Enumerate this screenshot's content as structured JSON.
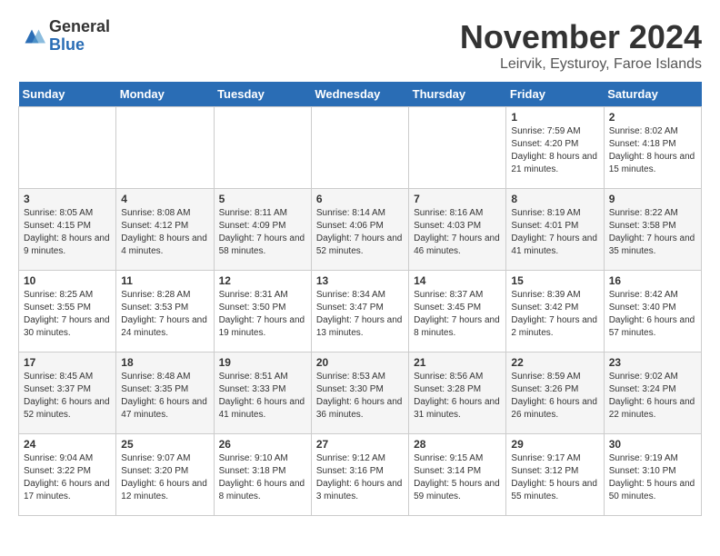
{
  "logo": {
    "general": "General",
    "blue": "Blue"
  },
  "title": "November 2024",
  "subtitle": "Leirvik, Eysturoy, Faroe Islands",
  "weekdays": [
    "Sunday",
    "Monday",
    "Tuesday",
    "Wednesday",
    "Thursday",
    "Friday",
    "Saturday"
  ],
  "weeks": [
    [
      {
        "day": "",
        "info": ""
      },
      {
        "day": "",
        "info": ""
      },
      {
        "day": "",
        "info": ""
      },
      {
        "day": "",
        "info": ""
      },
      {
        "day": "",
        "info": ""
      },
      {
        "day": "1",
        "info": "Sunrise: 7:59 AM\nSunset: 4:20 PM\nDaylight: 8 hours and 21 minutes."
      },
      {
        "day": "2",
        "info": "Sunrise: 8:02 AM\nSunset: 4:18 PM\nDaylight: 8 hours and 15 minutes."
      }
    ],
    [
      {
        "day": "3",
        "info": "Sunrise: 8:05 AM\nSunset: 4:15 PM\nDaylight: 8 hours and 9 minutes."
      },
      {
        "day": "4",
        "info": "Sunrise: 8:08 AM\nSunset: 4:12 PM\nDaylight: 8 hours and 4 minutes."
      },
      {
        "day": "5",
        "info": "Sunrise: 8:11 AM\nSunset: 4:09 PM\nDaylight: 7 hours and 58 minutes."
      },
      {
        "day": "6",
        "info": "Sunrise: 8:14 AM\nSunset: 4:06 PM\nDaylight: 7 hours and 52 minutes."
      },
      {
        "day": "7",
        "info": "Sunrise: 8:16 AM\nSunset: 4:03 PM\nDaylight: 7 hours and 46 minutes."
      },
      {
        "day": "8",
        "info": "Sunrise: 8:19 AM\nSunset: 4:01 PM\nDaylight: 7 hours and 41 minutes."
      },
      {
        "day": "9",
        "info": "Sunrise: 8:22 AM\nSunset: 3:58 PM\nDaylight: 7 hours and 35 minutes."
      }
    ],
    [
      {
        "day": "10",
        "info": "Sunrise: 8:25 AM\nSunset: 3:55 PM\nDaylight: 7 hours and 30 minutes."
      },
      {
        "day": "11",
        "info": "Sunrise: 8:28 AM\nSunset: 3:53 PM\nDaylight: 7 hours and 24 minutes."
      },
      {
        "day": "12",
        "info": "Sunrise: 8:31 AM\nSunset: 3:50 PM\nDaylight: 7 hours and 19 minutes."
      },
      {
        "day": "13",
        "info": "Sunrise: 8:34 AM\nSunset: 3:47 PM\nDaylight: 7 hours and 13 minutes."
      },
      {
        "day": "14",
        "info": "Sunrise: 8:37 AM\nSunset: 3:45 PM\nDaylight: 7 hours and 8 minutes."
      },
      {
        "day": "15",
        "info": "Sunrise: 8:39 AM\nSunset: 3:42 PM\nDaylight: 7 hours and 2 minutes."
      },
      {
        "day": "16",
        "info": "Sunrise: 8:42 AM\nSunset: 3:40 PM\nDaylight: 6 hours and 57 minutes."
      }
    ],
    [
      {
        "day": "17",
        "info": "Sunrise: 8:45 AM\nSunset: 3:37 PM\nDaylight: 6 hours and 52 minutes."
      },
      {
        "day": "18",
        "info": "Sunrise: 8:48 AM\nSunset: 3:35 PM\nDaylight: 6 hours and 47 minutes."
      },
      {
        "day": "19",
        "info": "Sunrise: 8:51 AM\nSunset: 3:33 PM\nDaylight: 6 hours and 41 minutes."
      },
      {
        "day": "20",
        "info": "Sunrise: 8:53 AM\nSunset: 3:30 PM\nDaylight: 6 hours and 36 minutes."
      },
      {
        "day": "21",
        "info": "Sunrise: 8:56 AM\nSunset: 3:28 PM\nDaylight: 6 hours and 31 minutes."
      },
      {
        "day": "22",
        "info": "Sunrise: 8:59 AM\nSunset: 3:26 PM\nDaylight: 6 hours and 26 minutes."
      },
      {
        "day": "23",
        "info": "Sunrise: 9:02 AM\nSunset: 3:24 PM\nDaylight: 6 hours and 22 minutes."
      }
    ],
    [
      {
        "day": "24",
        "info": "Sunrise: 9:04 AM\nSunset: 3:22 PM\nDaylight: 6 hours and 17 minutes."
      },
      {
        "day": "25",
        "info": "Sunrise: 9:07 AM\nSunset: 3:20 PM\nDaylight: 6 hours and 12 minutes."
      },
      {
        "day": "26",
        "info": "Sunrise: 9:10 AM\nSunset: 3:18 PM\nDaylight: 6 hours and 8 minutes."
      },
      {
        "day": "27",
        "info": "Sunrise: 9:12 AM\nSunset: 3:16 PM\nDaylight: 6 hours and 3 minutes."
      },
      {
        "day": "28",
        "info": "Sunrise: 9:15 AM\nSunset: 3:14 PM\nDaylight: 5 hours and 59 minutes."
      },
      {
        "day": "29",
        "info": "Sunrise: 9:17 AM\nSunset: 3:12 PM\nDaylight: 5 hours and 55 minutes."
      },
      {
        "day": "30",
        "info": "Sunrise: 9:19 AM\nSunset: 3:10 PM\nDaylight: 5 hours and 50 minutes."
      }
    ]
  ]
}
